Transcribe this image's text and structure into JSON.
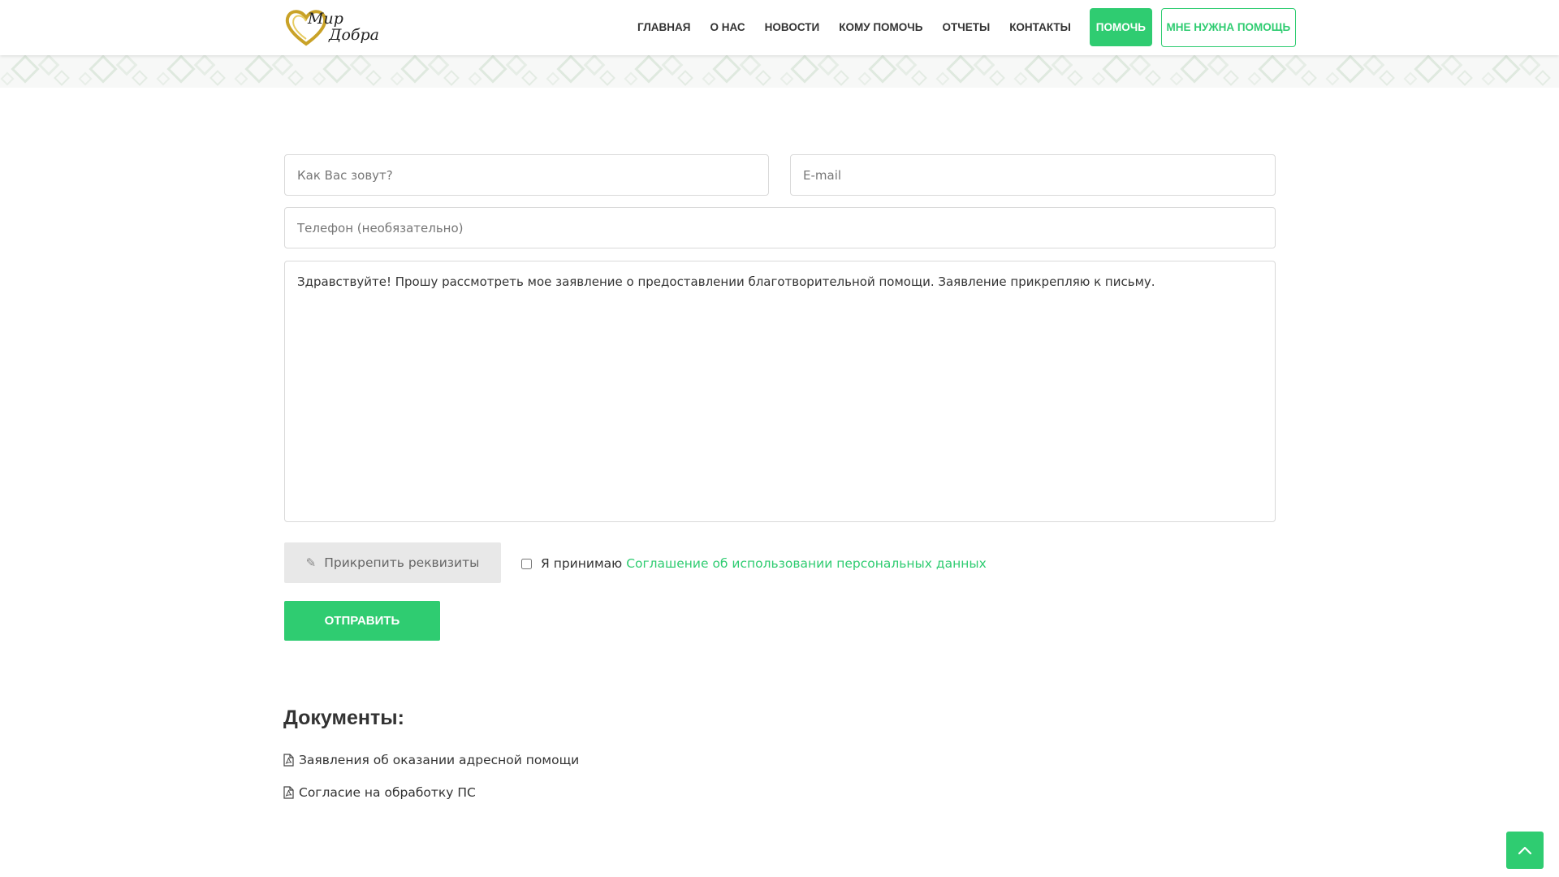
{
  "header": {
    "logo": {
      "line1": "Мир",
      "line2": "Добра"
    },
    "nav": [
      {
        "label": "ГЛАВНАЯ"
      },
      {
        "label": "О НАС"
      },
      {
        "label": "НОВОСТИ"
      },
      {
        "label": "КОМУ ПОМОЧЬ"
      },
      {
        "label": "ОТЧЕТЫ"
      },
      {
        "label": "КОНТАКТЫ"
      }
    ],
    "help_button": "ПОМОЧЬ",
    "need_help_button": "МНЕ НУЖНА ПОМОЩЬ"
  },
  "form": {
    "name_placeholder": "Как Вас зовут?",
    "email_placeholder": "E-mail",
    "phone_placeholder": "Телефон (необязательно)",
    "message_value": "Здравствуйте! Прошу рассмотреть мое заявление о предоставлении благотворительной помощи. Заявление прикрепляю к письму.",
    "attach_label": "Прикрепить реквизиты",
    "agree_prefix": "Я принимаю",
    "agree_link": "Соглашение об использовании персональных данных",
    "agree_checked": false,
    "submit_label": "ОТПРАВИТЬ"
  },
  "documents": {
    "title": "Документы:",
    "items": [
      {
        "label": "Заявления об оказании адресной помощи",
        "icon": "pdf-file-icon"
      },
      {
        "label": "Согласие на обработку ПС",
        "icon": "pdf-file-icon"
      }
    ]
  },
  "colors": {
    "accent": "#2fcc71",
    "text": "#333333",
    "muted": "#777777",
    "border": "#d9d9d9",
    "attach_bg": "#e8e8e8",
    "logo_gold": "#c9a227"
  },
  "icons": {
    "scroll_top": "chevron-up-icon",
    "attach": "paperclip-icon"
  }
}
